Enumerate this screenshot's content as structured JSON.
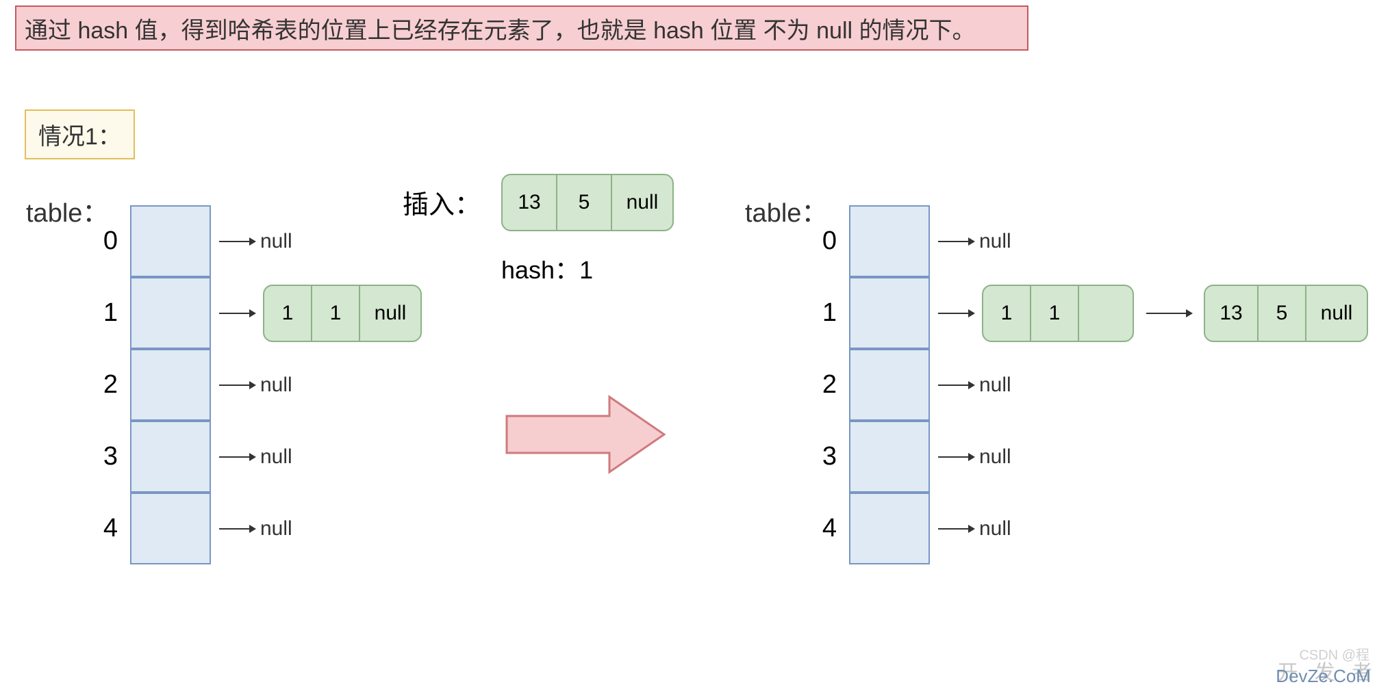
{
  "description": "通过 hash 值，得到哈希表的位置上已经存在元素了，也就是 hash 位置 不为 null 的情况下。",
  "case_label": "情况1：",
  "insert": {
    "label": "插入：",
    "node": {
      "key": "13",
      "value": "5",
      "next": "null"
    },
    "hash_label": "hash：1"
  },
  "left_table": {
    "label": "table：",
    "rows": [
      {
        "index": "0",
        "content": "null"
      },
      {
        "index": "1",
        "content": "node",
        "node": {
          "key": "1",
          "value": "1",
          "next": "null"
        }
      },
      {
        "index": "2",
        "content": "null"
      },
      {
        "index": "3",
        "content": "null"
      },
      {
        "index": "4",
        "content": "null"
      }
    ]
  },
  "right_table": {
    "label": "table：",
    "rows": [
      {
        "index": "0",
        "content": "null"
      },
      {
        "index": "1",
        "content": "chain",
        "node1": {
          "key": "1",
          "value": "1",
          "next": ""
        },
        "node2": {
          "key": "13",
          "value": "5",
          "next": "null"
        }
      },
      {
        "index": "2",
        "content": "null"
      },
      {
        "index": "3",
        "content": "null"
      },
      {
        "index": "4",
        "content": "null"
      }
    ]
  },
  "watermarks": {
    "csdn": "CSDN @程",
    "kaifazhe": "开 发 者",
    "devze": "DevZe.CoM"
  }
}
